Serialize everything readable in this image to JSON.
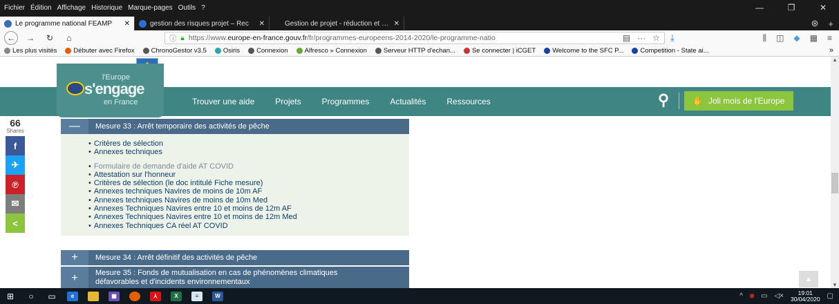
{
  "menubar": [
    "Fichier",
    "Édition",
    "Affichage",
    "Historique",
    "Marque-pages",
    "Outils",
    "?"
  ],
  "tabs": [
    {
      "title": "Le programme national FEAMP",
      "color": "#3d6fb0",
      "active": true
    },
    {
      "title": "gestion des risques projet – Rec",
      "color": "#2b6fd6",
      "active": false
    },
    {
      "title": "Gestion de projet - réduction et sui",
      "color": "#1a1a1a",
      "active": false
    }
  ],
  "address": {
    "prefix": "https://www.",
    "domain": "europe-en-france.gouv.fr",
    "path": "/fr/programmes-europeens-2014-2020/le-programme-natio"
  },
  "bookmarks": [
    {
      "label": "Les plus visités",
      "color": "#888"
    },
    {
      "label": "Débuter avec Firefox",
      "color": "#e66000"
    },
    {
      "label": "ChronoGestor v3.5",
      "color": "#555"
    },
    {
      "label": "Osiris",
      "color": "#2aa"
    },
    {
      "label": "Connexion",
      "color": "#555"
    },
    {
      "label": "Alfresco » Connexion",
      "color": "#6a3"
    },
    {
      "label": "Serveur HTTP d'echan...",
      "color": "#555"
    },
    {
      "label": "Se connecter | iCGET",
      "color": "#c33"
    },
    {
      "label": "Welcome to the SFC P...",
      "color": "#1a3fa8"
    },
    {
      "label": "Competition - State ai...",
      "color": "#1a3fa8"
    }
  ],
  "logo": {
    "line1": "l'Europe",
    "line2": "s'engage",
    "line3": "en France"
  },
  "nav": [
    "Trouver une aide",
    "Projets",
    "Programmes",
    "Actualités",
    "Ressources"
  ],
  "cta": "Joli mois de l'Europe",
  "share": {
    "count": "66",
    "label": "Shares",
    "buttons": [
      {
        "name": "facebook",
        "glyph": "f",
        "color": "#3b5998"
      },
      {
        "name": "twitter",
        "glyph": "✈",
        "color": "#1da1f2"
      },
      {
        "name": "pinterest",
        "glyph": "℗",
        "color": "#cb2027"
      },
      {
        "name": "email",
        "glyph": "✉",
        "color": "#7d7d7d"
      },
      {
        "name": "share",
        "glyph": "<",
        "color": "#8cc63f"
      }
    ]
  },
  "mesure33": {
    "title": "Mesure 33 : Arrêt temporaire des activités de pêche",
    "group1": [
      "Critères de sélection",
      "Annexes techniques"
    ],
    "group2": [
      {
        "text": "Formulaire de demande d'aide AT COVID",
        "grey": true
      },
      {
        "text": "Attestation sur l'honneur",
        "grey": false
      },
      {
        "text": "Critères de sélection (le doc intitulé Fiche mesure)",
        "grey": false
      },
      {
        "text": "Annexes techniques Navires de moins de 10m AF",
        "grey": false
      },
      {
        "text": "Annexes techniques Navires de moins de 10m Med",
        "grey": false
      },
      {
        "text": "Annexes Techniques Navires entre 10 et moins de 12m AF",
        "grey": false
      },
      {
        "text": "Annexes Techniques Navires entre 10 et moins de 12m Med",
        "grey": false
      },
      {
        "text": "Annexes Techniques CA réel AT COVID",
        "grey": false
      }
    ]
  },
  "mesure34": {
    "title": "Mesure 34 : Arrêt définitif des activités de pêche"
  },
  "mesure35": {
    "title": "Mesure 35 : Fonds de mutualisation en cas de phénomènes climatiques défavorables et d'incidents environnementaux"
  },
  "clock": {
    "time": "19:01",
    "date": "30/04/2020"
  }
}
